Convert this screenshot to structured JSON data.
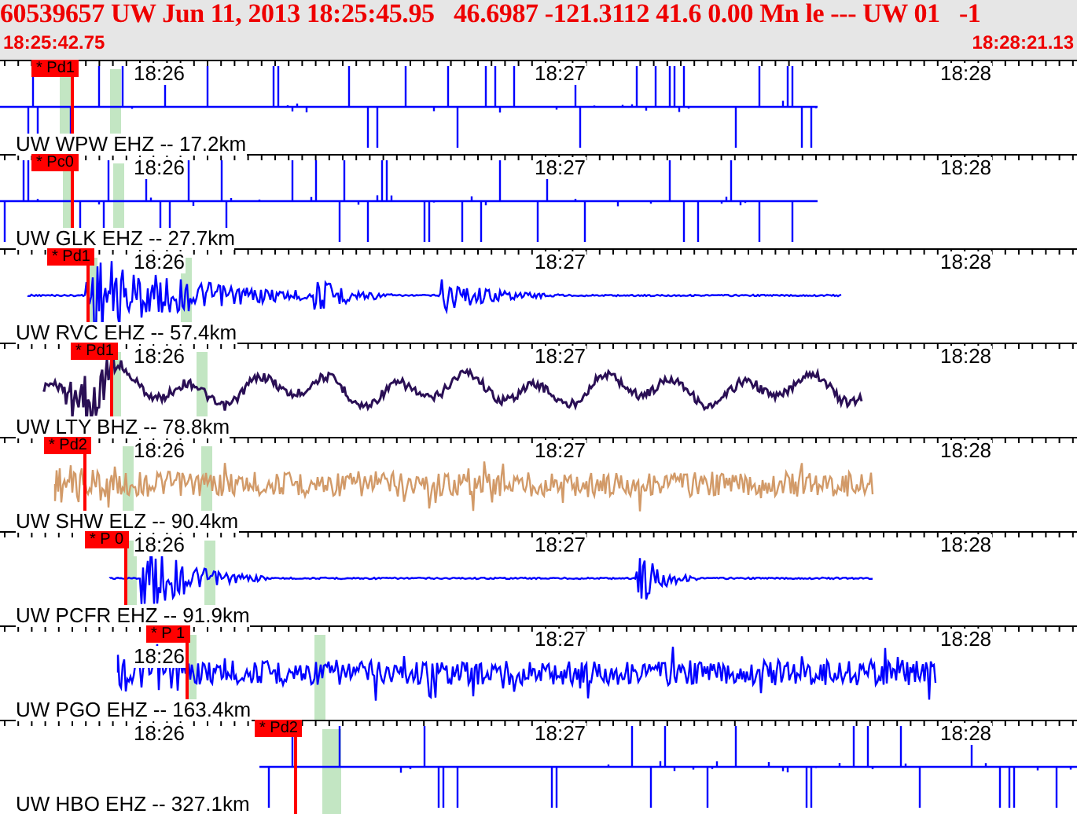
{
  "header": {
    "title": "60539657 UW Jun 11, 2013 18:25:45.95   46.6987 -121.3112 41.6 0.00 Mn le --- UW 01   -1",
    "start_time": "18:25:42.75",
    "end_time": "18:28:21.13"
  },
  "traces": [
    {
      "station": "UW WPW EHZ -- 17.2km",
      "pick": "* Pd1",
      "times": [
        "18:26",
        "18:27",
        "18:28"
      ],
      "kind": "spikes",
      "color": "#0000ff"
    },
    {
      "station": "UW GLK EHZ -- 27.7km",
      "pick": "* Pc0",
      "times": [
        "18:26",
        "18:27",
        "18:28"
      ],
      "kind": "spikes",
      "color": "#0000ff"
    },
    {
      "station": "UW RVC EHZ -- 57.4km",
      "pick": "* Pd1",
      "times": [
        "18:26",
        "18:27",
        "18:28"
      ],
      "kind": "event",
      "color": "#0000ff"
    },
    {
      "station": "UW LTY BHZ -- 78.8km",
      "pick": "* Pd1",
      "times": [
        "18:26",
        "18:27",
        "18:28"
      ],
      "kind": "wavy",
      "color": "#2a0f55"
    },
    {
      "station": "UW SHW ELZ -- 90.4km",
      "pick": "* Pd2",
      "times": [
        "18:26",
        "18:27",
        "18:28"
      ],
      "kind": "noise",
      "color": "#d29a68"
    },
    {
      "station": "UW PCFR EHZ -- 91.9km",
      "pick": "* P 0",
      "times": [
        "18:26",
        "18:27",
        "18:28"
      ],
      "kind": "event",
      "color": "#0000ff"
    },
    {
      "station": "UW PGO EHZ -- 163.4km",
      "pick": "* P 1",
      "times": [
        "18:26",
        "18:27",
        "18:28"
      ],
      "kind": "noise",
      "color": "#0000ff"
    },
    {
      "station": "UW HBO EHZ -- 327.1km",
      "pick": "* Pd2",
      "times": [
        "18:26",
        "18:27",
        "18:28"
      ],
      "kind": "spikes",
      "color": "#0000ff"
    }
  ]
}
